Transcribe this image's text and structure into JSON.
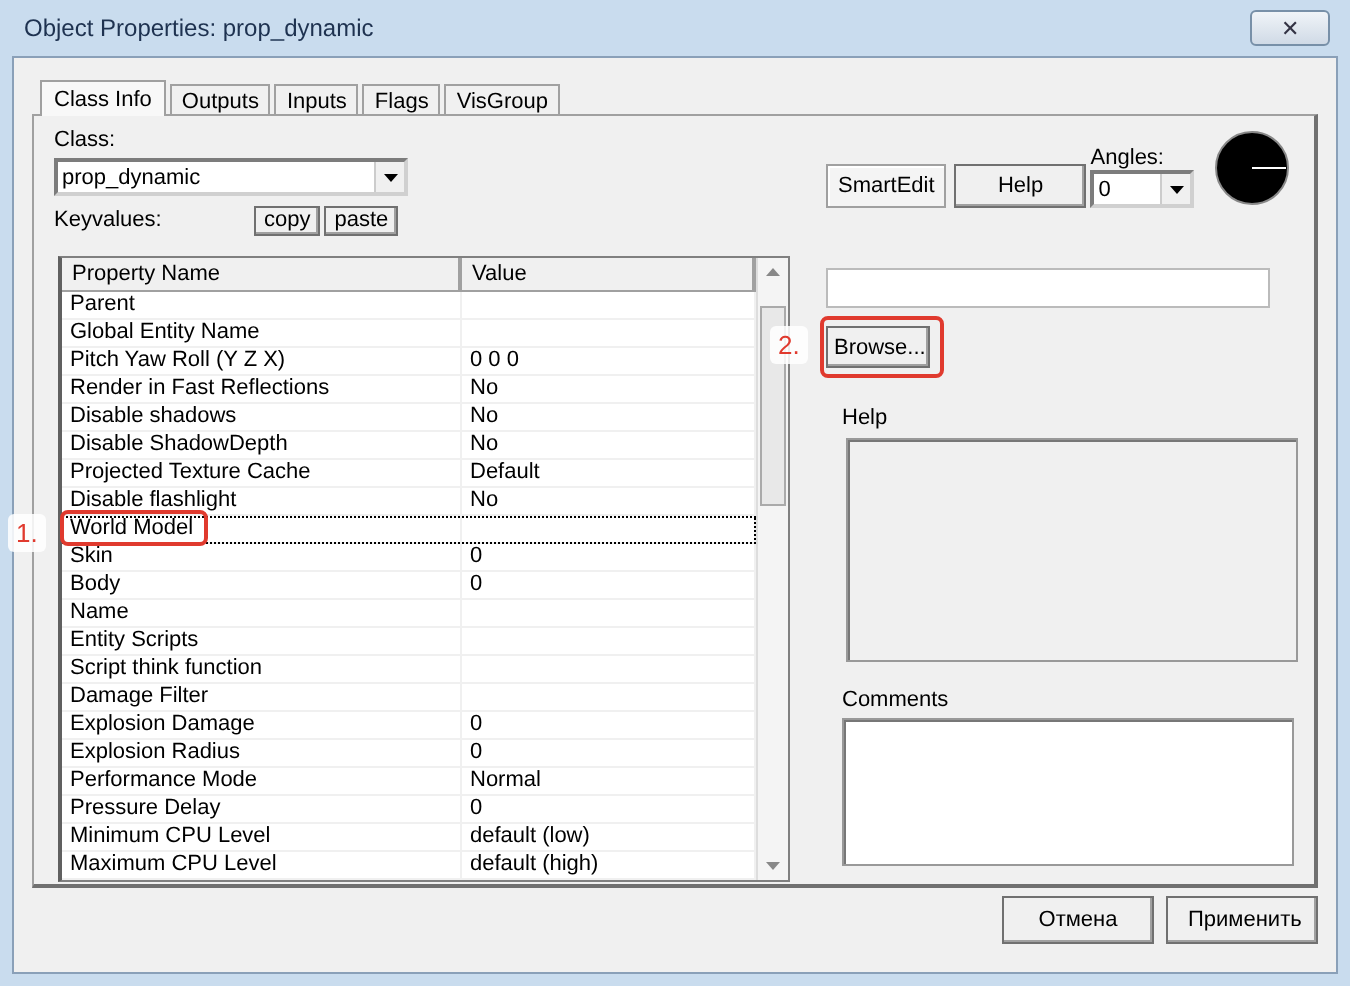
{
  "window": {
    "title": "Object Properties: prop_dynamic",
    "close": "✕"
  },
  "tabs": [
    {
      "label": "Class Info",
      "selected": true
    },
    {
      "label": "Outputs",
      "selected": false
    },
    {
      "label": "Inputs",
      "selected": false
    },
    {
      "label": "Flags",
      "selected": false
    },
    {
      "label": "VisGroup",
      "selected": false
    }
  ],
  "class_label": "Class:",
  "class_value": "prop_dynamic",
  "keyvalues_label": "Keyvalues:",
  "keyvalue_buttons": [
    "copy",
    "paste"
  ],
  "smartedit": {
    "label": "SmartEdit",
    "on": true
  },
  "help_button": "Help",
  "angles": {
    "label": "Angles:",
    "value": "0"
  },
  "table": {
    "columns": [
      "Property Name",
      "Value"
    ],
    "rows": [
      {
        "name": "Parent",
        "value": "",
        "selected": false
      },
      {
        "name": "Global Entity Name",
        "value": "",
        "selected": false
      },
      {
        "name": "Pitch Yaw Roll (Y Z X)",
        "value": "0 0 0",
        "selected": false
      },
      {
        "name": "Render in Fast Reflections",
        "value": "No",
        "selected": false
      },
      {
        "name": "Disable shadows",
        "value": "No",
        "selected": false
      },
      {
        "name": "Disable ShadowDepth",
        "value": "No",
        "selected": false
      },
      {
        "name": "Projected Texture Cache",
        "value": "Default",
        "selected": false
      },
      {
        "name": "Disable flashlight",
        "value": "No",
        "selected": false
      },
      {
        "name": "World Model",
        "value": "",
        "selected": true
      },
      {
        "name": "Skin",
        "value": "0",
        "selected": false
      },
      {
        "name": "Body",
        "value": "0",
        "selected": false
      },
      {
        "name": "Name",
        "value": "",
        "selected": false
      },
      {
        "name": "Entity Scripts",
        "value": "",
        "selected": false
      },
      {
        "name": "Script think function",
        "value": "",
        "selected": false
      },
      {
        "name": "Damage Filter",
        "value": "",
        "selected": false
      },
      {
        "name": "Explosion Damage",
        "value": "0",
        "selected": false
      },
      {
        "name": "Explosion Radius",
        "value": "0",
        "selected": false
      },
      {
        "name": "Performance Mode",
        "value": "Normal",
        "selected": false
      },
      {
        "name": "Pressure Delay",
        "value": "0",
        "selected": false
      },
      {
        "name": "Minimum CPU Level",
        "value": "default (low)",
        "selected": false
      },
      {
        "name": "Maximum CPU Level",
        "value": "default (high)",
        "selected": false
      }
    ]
  },
  "browse_button": "Browse...",
  "help_label": "Help",
  "comments_label": "Comments",
  "annotations": [
    "1.",
    "2."
  ],
  "footer_buttons": [
    "Отмена",
    "Применить"
  ]
}
